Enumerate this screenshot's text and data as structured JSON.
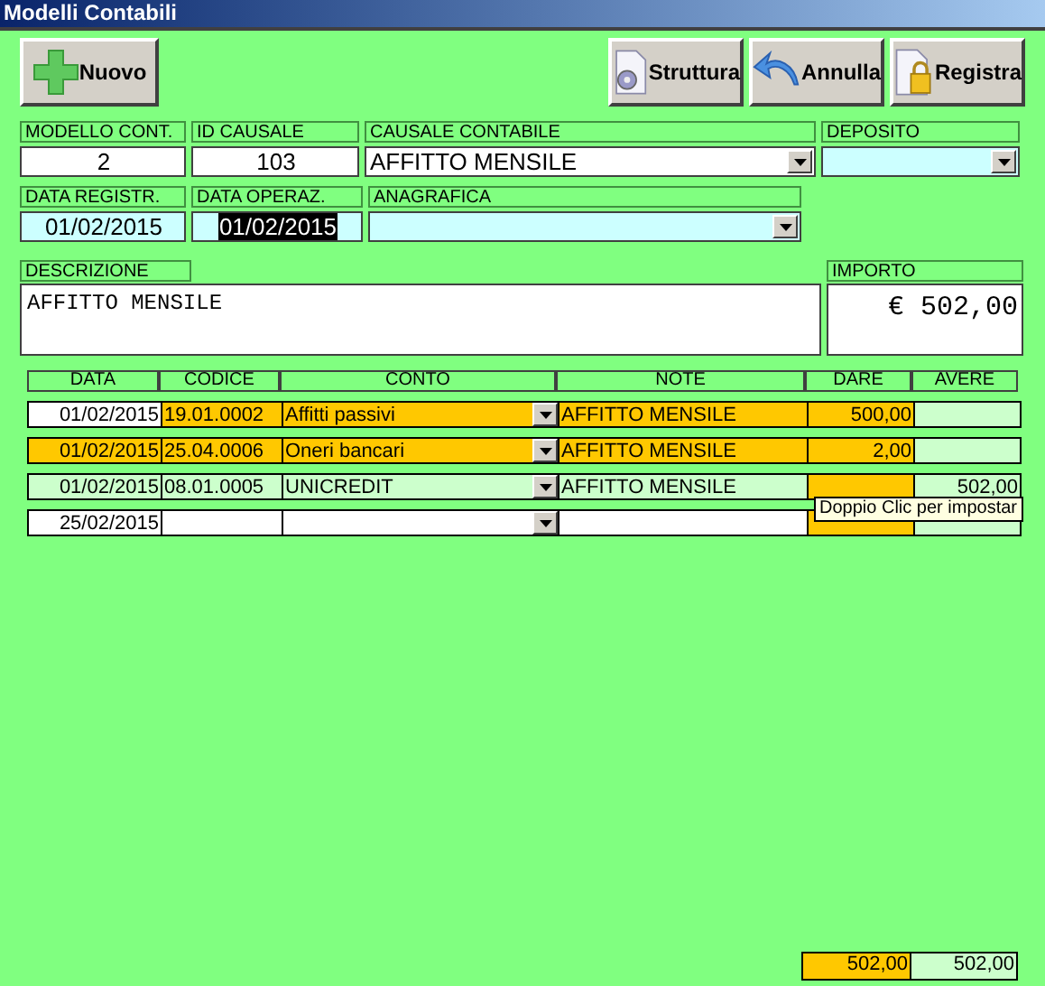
{
  "window": {
    "title": "Modelli Contabili"
  },
  "toolbar": {
    "left": [
      {
        "label": "Nuovo",
        "kind": "plus"
      }
    ],
    "right": [
      {
        "label": "Struttura",
        "kind": "gear"
      },
      {
        "label": "Annulla",
        "kind": "undo"
      },
      {
        "label": "Registra",
        "kind": "lock"
      }
    ]
  },
  "fields_row1": [
    {
      "label": "MODELLO CONT.",
      "value": "2",
      "kind": "text",
      "color": "#ffffff"
    },
    {
      "label": "ID CAUSALE",
      "value": "103",
      "kind": "text",
      "color": "#ffffff"
    },
    {
      "label": "CAUSALE CONTABILE",
      "value": "AFFITTO MENSILE",
      "kind": "combo",
      "color": "#ffffff"
    },
    {
      "label": "DEPOSITO",
      "kind": "combo",
      "color": "#ccffff"
    }
  ],
  "fields_row2": [
    {
      "label": "DATA REGISTR.",
      "value": "01/02/2015",
      "kind": "text",
      "color": "#ccffff",
      "selected": false
    },
    {
      "label": "DATA OPERAZ.",
      "value": "01/02/2015",
      "kind": "text",
      "color": "#ccffff",
      "selected": true
    },
    {
      "label": "ANAGRAFICA",
      "kind": "combo",
      "color": "#ccffff"
    }
  ],
  "description": {
    "label": "DESCRIZIONE",
    "value": "AFFITTO MENSILE"
  },
  "amount": {
    "label": "IMPORTO",
    "value": "€ 502,00"
  },
  "grid": {
    "columns": [
      "DATA",
      "CODICE",
      "CONTO",
      "NOTE",
      "DARE",
      "AVERE"
    ],
    "rows": [
      {
        "cells": [
          {
            "text": "01/02/2015",
            "color": "#ffffff"
          },
          {
            "text": "19.01.0002",
            "color": "#ffc800"
          },
          {
            "text": "Affitti passivi",
            "color": "#ffc800"
          },
          {
            "text": "AFFITTO MENSILE",
            "color": "#ffc800"
          },
          {
            "text": "500,00",
            "color": "#ffc800"
          },
          {
            "color": "#ccffcc"
          }
        ]
      },
      {
        "cells": [
          {
            "text": "01/02/2015",
            "color": "#ffc800"
          },
          {
            "text": "25.04.0006",
            "color": "#ffc800"
          },
          {
            "text": "Oneri bancari",
            "color": "#ffc800"
          },
          {
            "text": "AFFITTO MENSILE",
            "color": "#ffc800"
          },
          {
            "text": "2,00",
            "color": "#ffc800"
          },
          {
            "color": "#ccffcc"
          }
        ]
      },
      {
        "cells": [
          {
            "text": "01/02/2015",
            "color": "#ccffcc"
          },
          {
            "text": "08.01.0005",
            "color": "#ccffcc"
          },
          {
            "text": "UNICREDIT",
            "color": "#ccffcc"
          },
          {
            "text": "AFFITTO MENSILE",
            "color": "#ccffcc"
          },
          {
            "color": "#ffc800"
          },
          {
            "text": "502,00",
            "color": "#ccffcc"
          }
        ]
      },
      {
        "cells": [
          {
            "text": "25/02/2015",
            "color": "#ffffff"
          },
          {
            "color": "#ffffff"
          },
          {
            "color": "#ffffff"
          },
          {
            "color": "#ffffff"
          },
          {
            "color": "#ffc800"
          },
          {
            "color": "#ccffcc"
          }
        ]
      }
    ],
    "tooltip": "Doppio Clic per impostar",
    "totals": {
      "dare": "502,00",
      "avere": "502,00"
    }
  }
}
